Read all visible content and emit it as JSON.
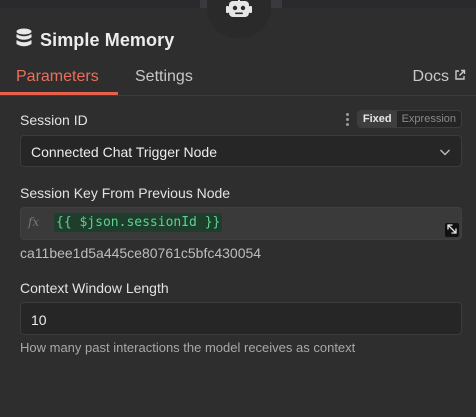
{
  "panel": {
    "title": "Simple Memory",
    "header_icon": "database-icon",
    "node_icon": "robot-icon"
  },
  "tabs": [
    {
      "label": "Parameters",
      "active": true
    },
    {
      "label": "Settings",
      "active": false
    }
  ],
  "docs_label": "Docs",
  "session_id": {
    "label": "Session ID",
    "mode_fixed": "Fixed",
    "mode_expression": "Expression",
    "selected_mode": "Fixed",
    "value": "Connected Chat Trigger Node"
  },
  "session_key": {
    "label": "Session Key From Previous Node",
    "fx_symbol": "fx",
    "expression": "{{ $json.sessionId }}",
    "result": "ca11bee1d5a445ce80761c5bfc430054"
  },
  "context_window": {
    "label": "Context Window Length",
    "value": "10",
    "hint": "How many past interactions the model receives as context"
  },
  "colors": {
    "accent": "#e8604c",
    "background": "#2e2e2e",
    "expression_green": "#5fd18f"
  }
}
